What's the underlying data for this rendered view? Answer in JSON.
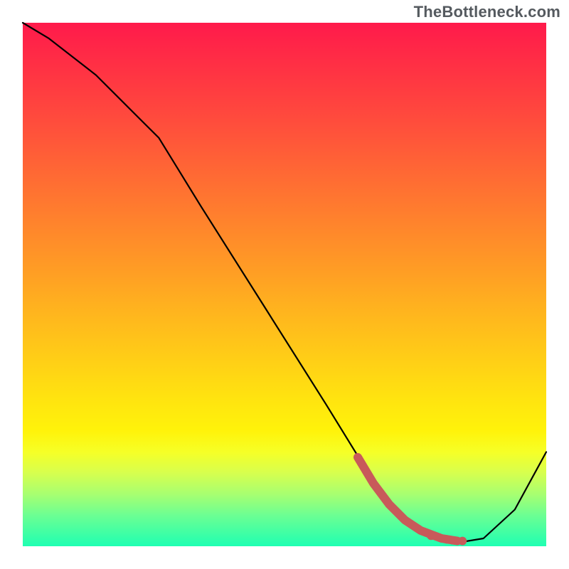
{
  "watermark": "TheBottleneck.com",
  "chart_data": {
    "type": "line",
    "title": "",
    "xlabel": "",
    "ylabel": "",
    "xlim": [
      0,
      100
    ],
    "ylim": [
      0,
      100
    ],
    "grid": false,
    "legend": false,
    "background_gradient": {
      "top": "#ff1a4b",
      "bottom": "#1fffb2",
      "note": "red→orange→yellow→green vertical gradient"
    },
    "series": [
      {
        "name": "bottleneck-curve",
        "stroke": "#000000",
        "x": [
          0,
          5,
          14,
          22,
          26,
          34,
          46,
          58,
          66,
          70,
          76,
          82,
          88,
          94,
          100
        ],
        "y": [
          100,
          97,
          90,
          82,
          78,
          65,
          46,
          27,
          14,
          8,
          3,
          0.5,
          1.5,
          7,
          18
        ]
      },
      {
        "name": "highlight-segment",
        "stroke": "#c85a5a",
        "x": [
          64,
          67,
          70,
          73,
          76,
          80,
          83
        ],
        "y": [
          17,
          12,
          8,
          5,
          3,
          1.5,
          1
        ]
      }
    ],
    "annotations": {
      "highlight_dots": [
        {
          "x": 78,
          "y": 2
        },
        {
          "x": 81,
          "y": 1.3
        },
        {
          "x": 84,
          "y": 1
        }
      ]
    }
  }
}
